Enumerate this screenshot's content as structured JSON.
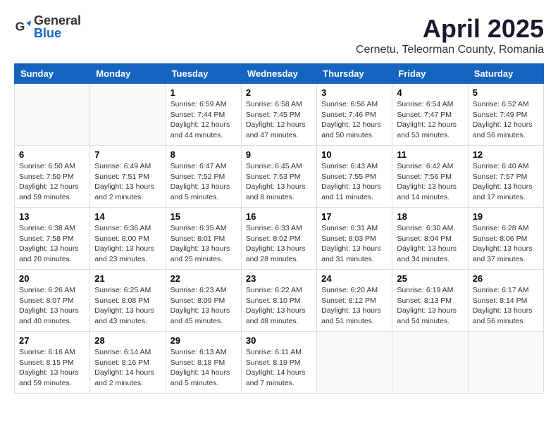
{
  "logo": {
    "general": "General",
    "blue": "Blue"
  },
  "title": "April 2025",
  "location": "Cernetu, Teleorman County, Romania",
  "days_of_week": [
    "Sunday",
    "Monday",
    "Tuesday",
    "Wednesday",
    "Thursday",
    "Friday",
    "Saturday"
  ],
  "weeks": [
    [
      {
        "day": "",
        "info": ""
      },
      {
        "day": "",
        "info": ""
      },
      {
        "day": "1",
        "info": "Sunrise: 6:59 AM\nSunset: 7:44 PM\nDaylight: 12 hours and 44 minutes."
      },
      {
        "day": "2",
        "info": "Sunrise: 6:58 AM\nSunset: 7:45 PM\nDaylight: 12 hours and 47 minutes."
      },
      {
        "day": "3",
        "info": "Sunrise: 6:56 AM\nSunset: 7:46 PM\nDaylight: 12 hours and 50 minutes."
      },
      {
        "day": "4",
        "info": "Sunrise: 6:54 AM\nSunset: 7:47 PM\nDaylight: 12 hours and 53 minutes."
      },
      {
        "day": "5",
        "info": "Sunrise: 6:52 AM\nSunset: 7:49 PM\nDaylight: 12 hours and 56 minutes."
      }
    ],
    [
      {
        "day": "6",
        "info": "Sunrise: 6:50 AM\nSunset: 7:50 PM\nDaylight: 12 hours and 59 minutes."
      },
      {
        "day": "7",
        "info": "Sunrise: 6:49 AM\nSunset: 7:51 PM\nDaylight: 13 hours and 2 minutes."
      },
      {
        "day": "8",
        "info": "Sunrise: 6:47 AM\nSunset: 7:52 PM\nDaylight: 13 hours and 5 minutes."
      },
      {
        "day": "9",
        "info": "Sunrise: 6:45 AM\nSunset: 7:53 PM\nDaylight: 13 hours and 8 minutes."
      },
      {
        "day": "10",
        "info": "Sunrise: 6:43 AM\nSunset: 7:55 PM\nDaylight: 13 hours and 11 minutes."
      },
      {
        "day": "11",
        "info": "Sunrise: 6:42 AM\nSunset: 7:56 PM\nDaylight: 13 hours and 14 minutes."
      },
      {
        "day": "12",
        "info": "Sunrise: 6:40 AM\nSunset: 7:57 PM\nDaylight: 13 hours and 17 minutes."
      }
    ],
    [
      {
        "day": "13",
        "info": "Sunrise: 6:38 AM\nSunset: 7:58 PM\nDaylight: 13 hours and 20 minutes."
      },
      {
        "day": "14",
        "info": "Sunrise: 6:36 AM\nSunset: 8:00 PM\nDaylight: 13 hours and 23 minutes."
      },
      {
        "day": "15",
        "info": "Sunrise: 6:35 AM\nSunset: 8:01 PM\nDaylight: 13 hours and 25 minutes."
      },
      {
        "day": "16",
        "info": "Sunrise: 6:33 AM\nSunset: 8:02 PM\nDaylight: 13 hours and 28 minutes."
      },
      {
        "day": "17",
        "info": "Sunrise: 6:31 AM\nSunset: 8:03 PM\nDaylight: 13 hours and 31 minutes."
      },
      {
        "day": "18",
        "info": "Sunrise: 6:30 AM\nSunset: 8:04 PM\nDaylight: 13 hours and 34 minutes."
      },
      {
        "day": "19",
        "info": "Sunrise: 6:28 AM\nSunset: 8:06 PM\nDaylight: 13 hours and 37 minutes."
      }
    ],
    [
      {
        "day": "20",
        "info": "Sunrise: 6:26 AM\nSunset: 8:07 PM\nDaylight: 13 hours and 40 minutes."
      },
      {
        "day": "21",
        "info": "Sunrise: 6:25 AM\nSunset: 8:08 PM\nDaylight: 13 hours and 43 minutes."
      },
      {
        "day": "22",
        "info": "Sunrise: 6:23 AM\nSunset: 8:09 PM\nDaylight: 13 hours and 45 minutes."
      },
      {
        "day": "23",
        "info": "Sunrise: 6:22 AM\nSunset: 8:10 PM\nDaylight: 13 hours and 48 minutes."
      },
      {
        "day": "24",
        "info": "Sunrise: 6:20 AM\nSunset: 8:12 PM\nDaylight: 13 hours and 51 minutes."
      },
      {
        "day": "25",
        "info": "Sunrise: 6:19 AM\nSunset: 8:13 PM\nDaylight: 13 hours and 54 minutes."
      },
      {
        "day": "26",
        "info": "Sunrise: 6:17 AM\nSunset: 8:14 PM\nDaylight: 13 hours and 56 minutes."
      }
    ],
    [
      {
        "day": "27",
        "info": "Sunrise: 6:16 AM\nSunset: 8:15 PM\nDaylight: 13 hours and 59 minutes."
      },
      {
        "day": "28",
        "info": "Sunrise: 6:14 AM\nSunset: 8:16 PM\nDaylight: 14 hours and 2 minutes."
      },
      {
        "day": "29",
        "info": "Sunrise: 6:13 AM\nSunset: 8:18 PM\nDaylight: 14 hours and 5 minutes."
      },
      {
        "day": "30",
        "info": "Sunrise: 6:11 AM\nSunset: 8:19 PM\nDaylight: 14 hours and 7 minutes."
      },
      {
        "day": "",
        "info": ""
      },
      {
        "day": "",
        "info": ""
      },
      {
        "day": "",
        "info": ""
      }
    ]
  ]
}
